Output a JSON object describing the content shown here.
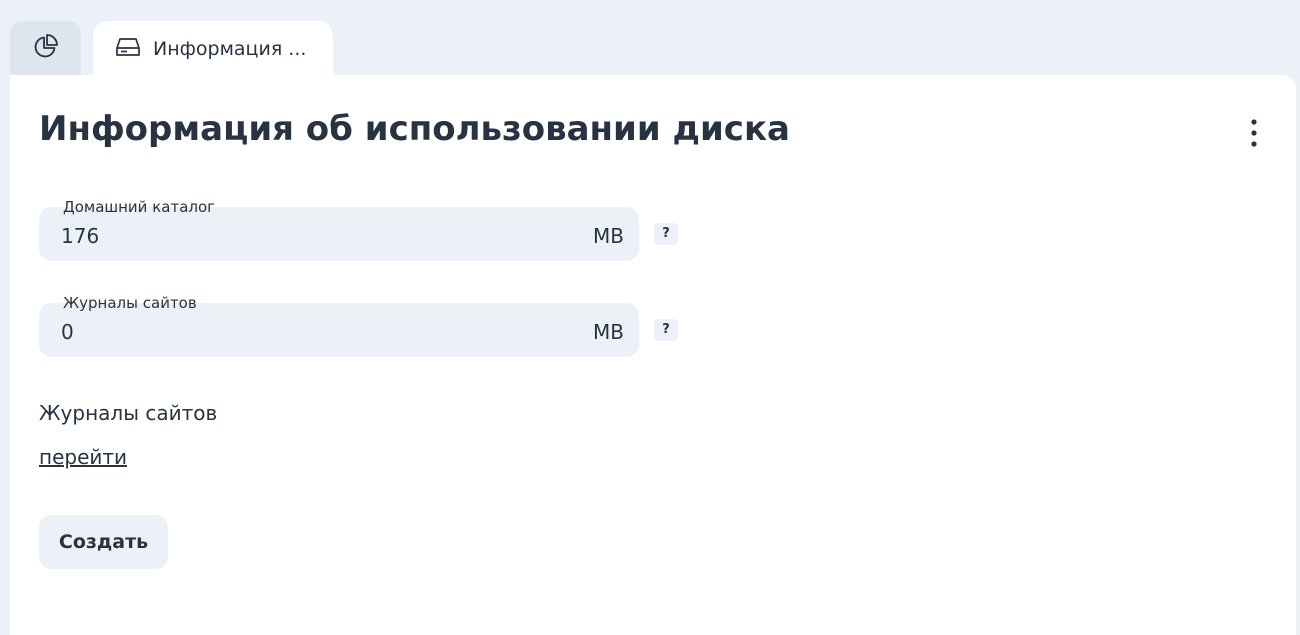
{
  "tabs": {
    "home": {
      "icon": "pie-chart-icon"
    },
    "active": {
      "icon": "hard-drive-icon",
      "label": "Информация ..."
    }
  },
  "page": {
    "title": "Информация об использовании диска",
    "menu_icon": "kebab-menu-icon"
  },
  "fields": [
    {
      "label": "Домашний каталог",
      "value": "176",
      "unit": "MB",
      "help": "?"
    },
    {
      "label": "Журналы сайтов",
      "value": "0",
      "unit": "MB",
      "help": "?"
    }
  ],
  "logs_section": {
    "label": "Журналы сайтов",
    "link": "перейти"
  },
  "actions": {
    "create_label": "Создать"
  },
  "colors": {
    "background": "#ecf1f8",
    "panel": "#ffffff",
    "text": "#283342",
    "field_bg": "#ecf1f8"
  }
}
